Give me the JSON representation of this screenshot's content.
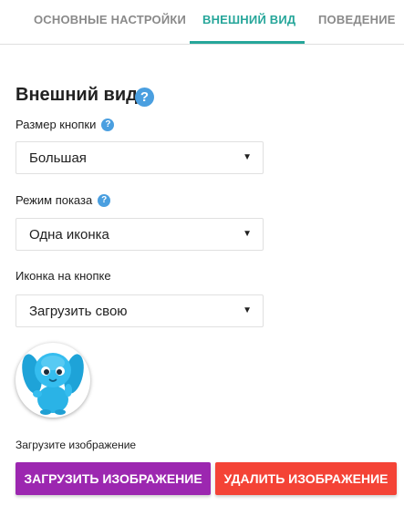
{
  "tabs": [
    {
      "label": "Основные настройки",
      "active": false
    },
    {
      "label": "Внешний вид",
      "active": true
    },
    {
      "label": "Поведение",
      "active": false
    }
  ],
  "section": {
    "title": "Внешний вид",
    "help_icon": "question-circle-icon"
  },
  "fields": {
    "button_size": {
      "label": "Размер кнопки",
      "value": "Большая"
    },
    "display_mode": {
      "label": "Режим показа",
      "value": "Одна иконка"
    },
    "button_icon": {
      "label": "Иконка на кнопке",
      "value": "Загрузить свою"
    }
  },
  "help_glyph": "?",
  "dropdown_glyph": "▼",
  "upload": {
    "label": "Загрузите изображение",
    "upload_button": "Загрузить изображение",
    "delete_button": "Удалить изображение"
  },
  "colors": {
    "accent": "#26a69a",
    "upload": "#9c27b0",
    "delete": "#f44336",
    "help": "#4a9fe0"
  }
}
